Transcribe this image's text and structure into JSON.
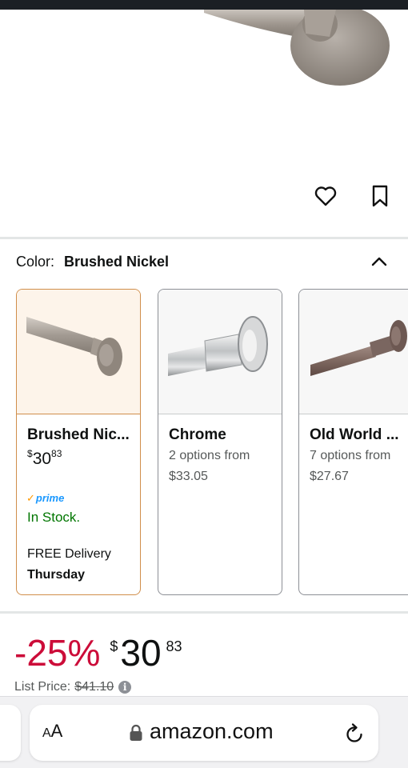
{
  "product": {
    "color_label": "Color:",
    "color_value": "Brushed Nickel"
  },
  "swatches": [
    {
      "name": "Brushed Nic...",
      "price_currency": "$",
      "price_whole": "30",
      "price_fraction": "83",
      "prime_label": "prime",
      "stock": "In Stock.",
      "delivery": "FREE Delivery",
      "delivery_day": "Thursday",
      "selected": true
    },
    {
      "name": "Chrome",
      "options": "2 options from",
      "from_price": "$33.05",
      "selected": false
    },
    {
      "name": "Old World ...",
      "options": "7 options from",
      "from_price": "$27.67",
      "selected": false
    }
  ],
  "pricing": {
    "discount": "-25%",
    "currency": "$",
    "whole": "30",
    "fraction": "83",
    "list_label": "List Price:",
    "list_value": "$41.10",
    "info_symbol": "i"
  },
  "browser": {
    "text_size_label_small": "A",
    "text_size_label_large": "A",
    "url": "amazon.com"
  },
  "icons": {
    "wishlist": "heart-icon",
    "save": "bookmark-icon",
    "collapse": "chevron-up-icon",
    "lock": "lock-icon",
    "reload": "reload-icon",
    "info": "info-icon"
  },
  "colors": {
    "discount": "#cc0c39",
    "in_stock": "#007600",
    "prime": "#1a98ff",
    "selected_border": "#d08e4b"
  }
}
